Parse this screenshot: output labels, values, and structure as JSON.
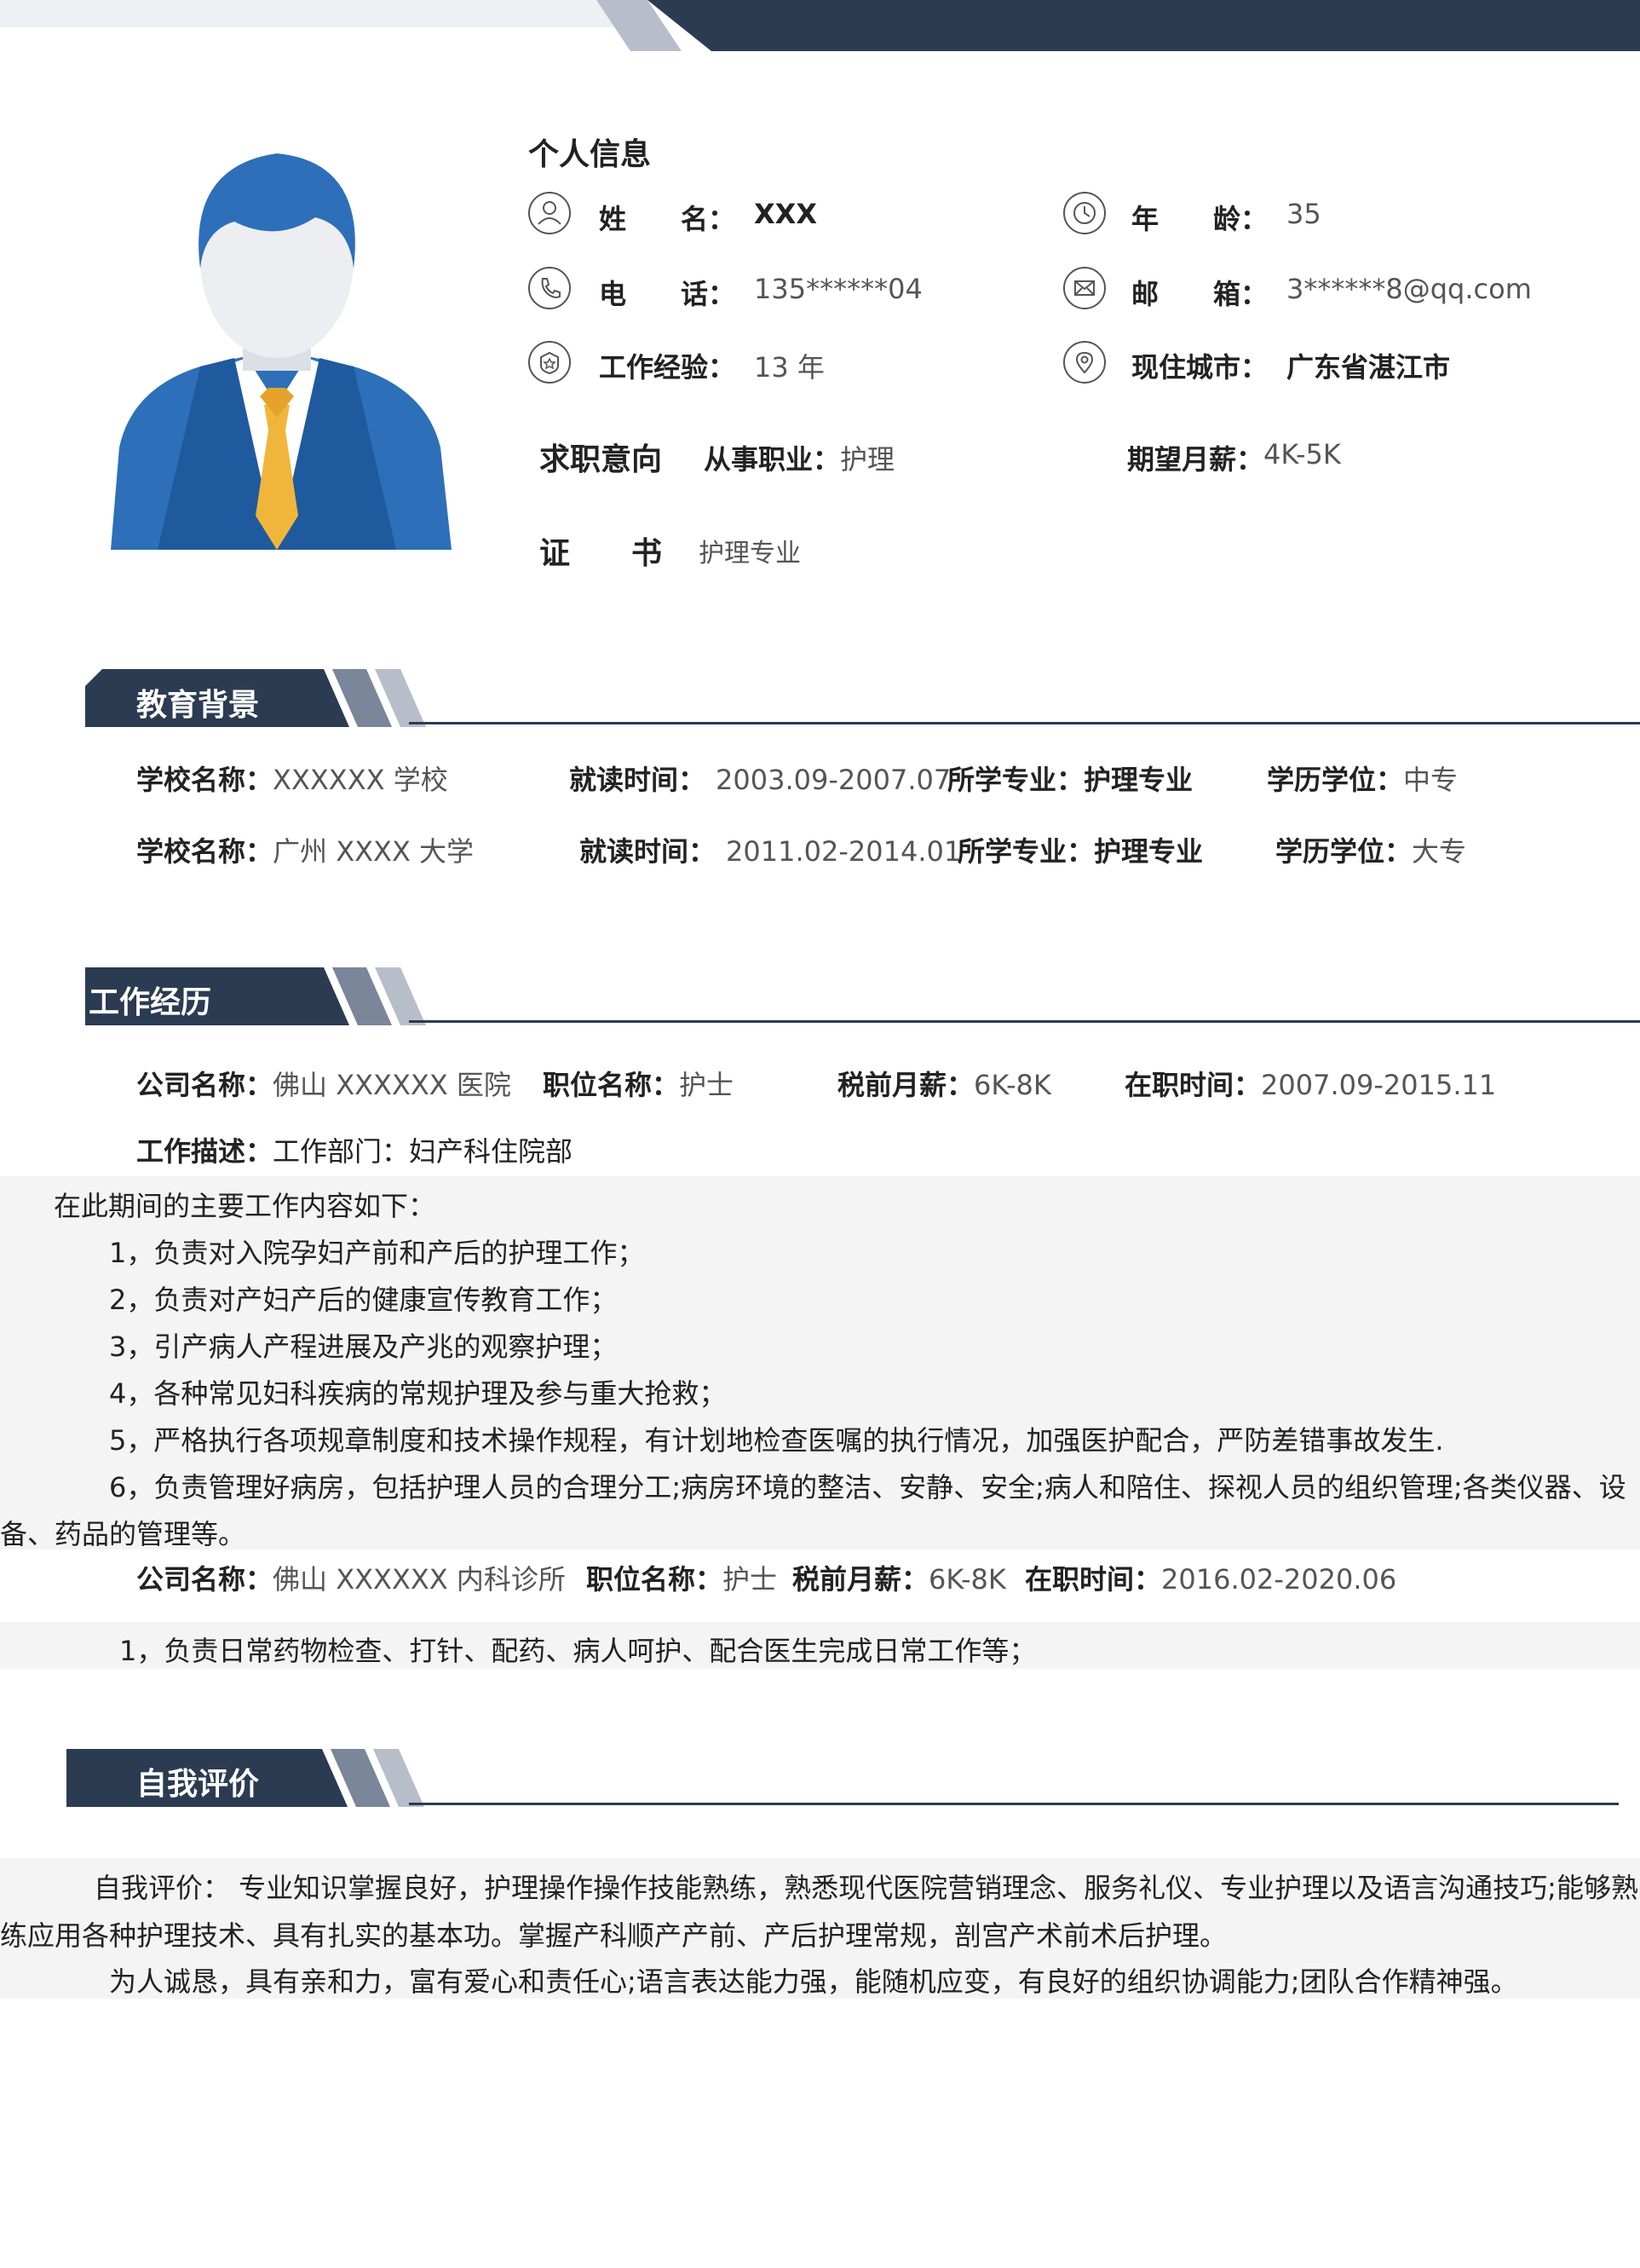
{
  "personal": {
    "heading": "个人信息",
    "name_label": "姓　　名：",
    "name": "XXX",
    "age_label": "年　　龄：",
    "age": "35",
    "phone_label": "电　　话：",
    "phone": "135******04",
    "email_label": "邮　　箱：",
    "email": "3******8@qq.com",
    "exp_label": "工作经验：",
    "exp": "13 年",
    "city_label": "现住城市：",
    "city": "广东省湛江市",
    "intent_label": "求职意向",
    "job_label": "从事职业：",
    "job": "护理",
    "salary_label": "期望月薪：",
    "salary": "4K-5K",
    "cert_label": "证　　书",
    "cert": "护理专业"
  },
  "education": {
    "heading": "教育背景",
    "rows": [
      {
        "school_label": "学校名称：",
        "school": "XXXXXX 学校",
        "time_label": "就读时间：",
        "time": "2003.09-2007.07",
        "major_label": "所学专业：",
        "major": "护理专业",
        "degree_label": "学历学位：",
        "degree": "中专"
      },
      {
        "school_label": "学校名称：",
        "school": "广州 XXXX 大学",
        "time_label": "就读时间：",
        "time": "2011.02-2014.01",
        "major_label": "所学专业：",
        "major": "护理专业",
        "degree_label": "学历学位：",
        "degree": "大专"
      }
    ]
  },
  "work": {
    "heading": "工作经历",
    "job1": {
      "company_label": "公司名称：",
      "company": "佛山 XXXXXX 医院",
      "position_label": "职位名称：",
      "position": "护士",
      "salary_label": "税前月薪：",
      "salary": "6K-8K",
      "period_label": "在职时间：",
      "period": "2007.09-2015.11",
      "desc_label": "工作描述：",
      "desc": "工作部门：妇产科住院部",
      "intro": "在此期间的主要工作内容如下：",
      "duties": [
        "1，负责对入院孕妇产前和产后的护理工作；",
        "2，负责对产妇产后的健康宣传教育工作；",
        "3，引产病人产程进展及产兆的观察护理；",
        "4，各种常见妇科疾病的常规护理及参与重大抢救；",
        "5，严格执行各项规章制度和技术操作规程，有计划地检查医嘱的执行情况，加强医护配合，严防差错事故发生.",
        "6，负责管理好病房，包括护理人员的合理分工;病房环境的整洁、安静、安全;病人和陪住、探视人员的组织管理;各类仪器、设",
        "备、药品的管理等。"
      ]
    },
    "job2": {
      "company_label": "公司名称：",
      "company": "佛山 XXXXXX 内科诊所",
      "position_label": "职位名称：",
      "position": "护士",
      "salary_label": "税前月薪：",
      "salary": "6K-8K",
      "period_label": "在职时间：",
      "period": "2016.02-2020.06",
      "duty": "1，负责日常药物检查、打针、配药、病人呵护、配合医生完成日常工作等；"
    }
  },
  "self": {
    "heading": "自我评价",
    "lines": [
      "自我评价：  专业知识掌握良好，护理操作操作技能熟练，熟悉现代医院营销理念、服务礼仪、专业护理以及语言沟通技巧;能够熟",
      "练应用各种护理技术、具有扎实的基本功。掌握产科顺产产前、产后护理常规，剖宫产术前术后护理。",
      "为人诚恳，具有亲和力，富有爱心和责任心;语言表达能力强，能随机应变，有良好的组织协调能力;团队合作精神强。"
    ]
  },
  "colors": {
    "navy": "#2b3b52",
    "slate": "#7a8699",
    "light": "#b7bec9",
    "avatar_blue": "#2d6fb8",
    "tie": "#f0b63c"
  }
}
